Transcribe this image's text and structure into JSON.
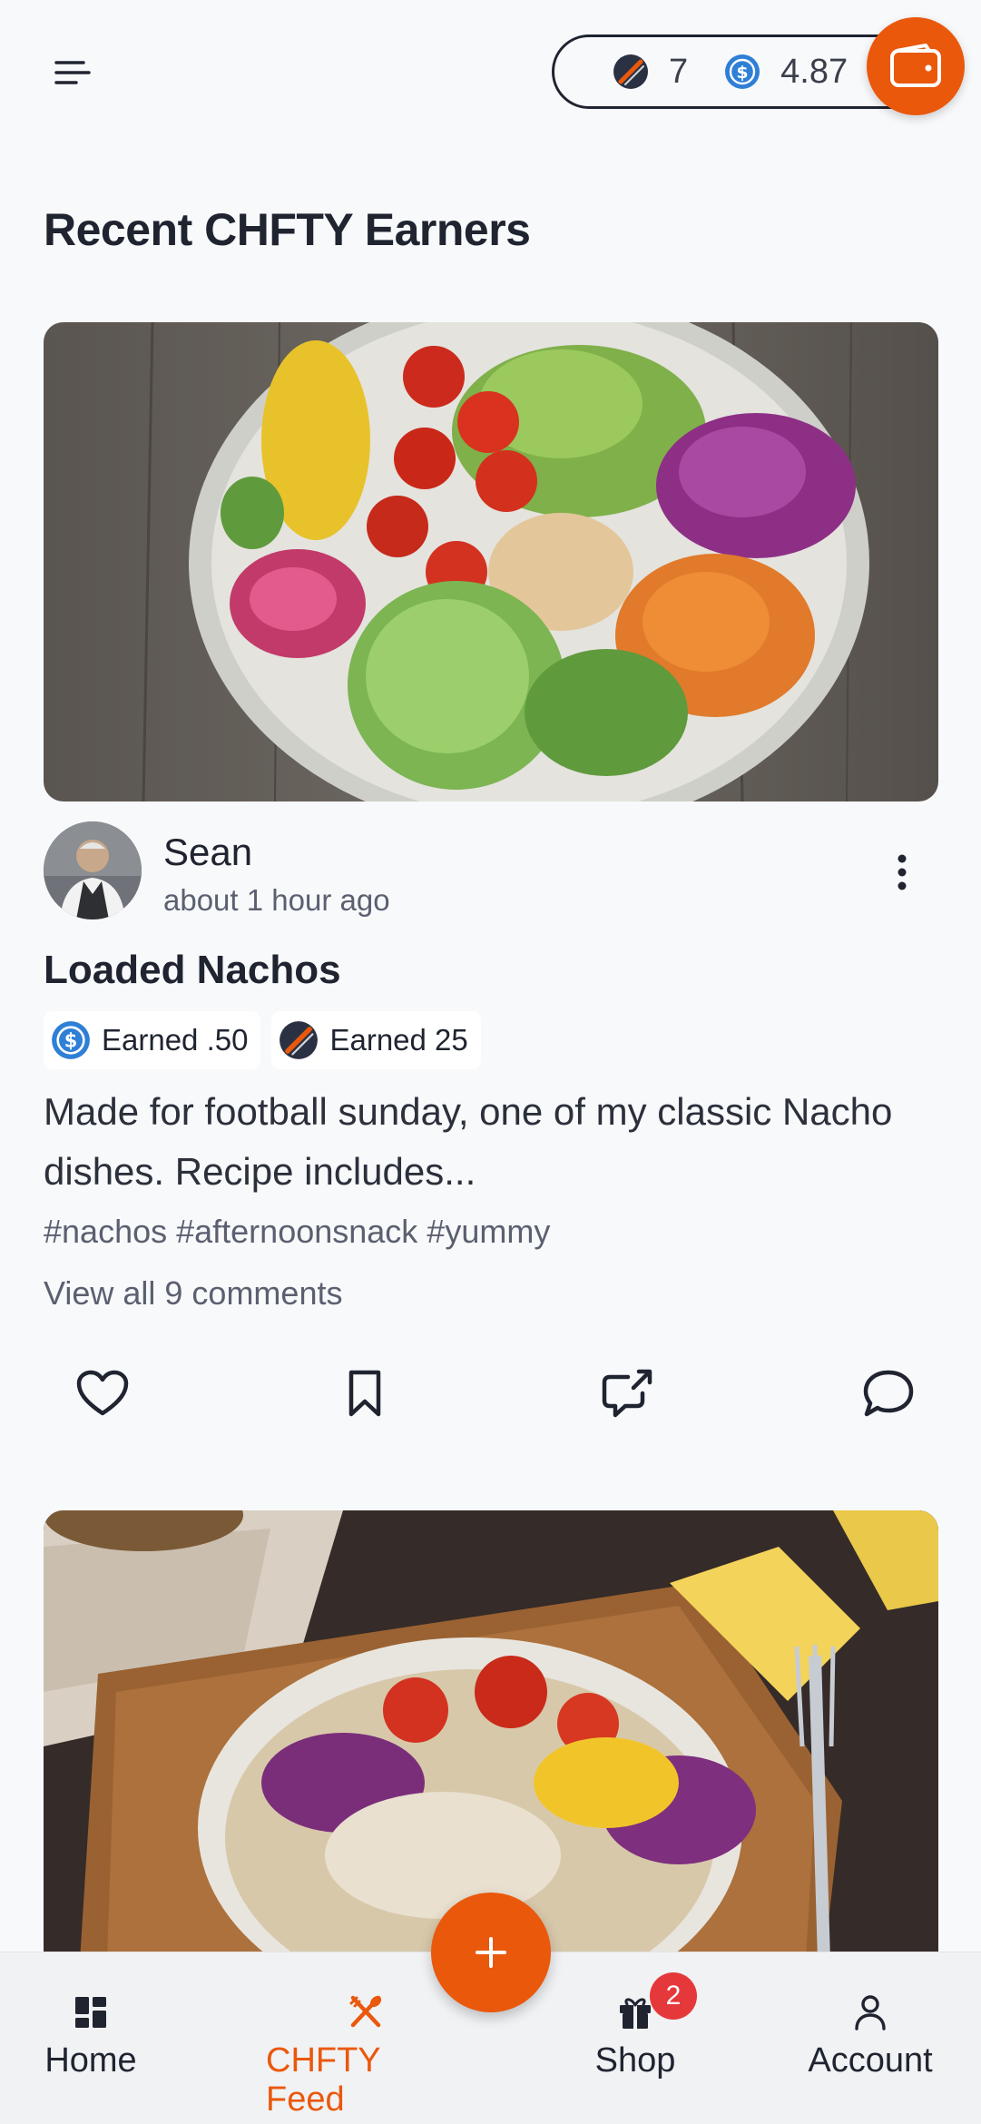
{
  "header": {
    "menu_icon": "menu-icon",
    "token_balance": "7",
    "coin_balance": "4.87",
    "wallet_icon": "wallet-icon"
  },
  "section": {
    "title": "Recent CHFTY Earners"
  },
  "post": {
    "author": "Sean",
    "time": "about 1 hour ago",
    "title": "Loaded Nachos",
    "badges": [
      {
        "icon": "dollar-coin-icon",
        "label": "Earned .50"
      },
      {
        "icon": "chfty-token-icon",
        "label": "Earned 25"
      }
    ],
    "description": "Made for football sunday, one of my classic Nacho dishes. Recipe includes...",
    "tags": "#nachos #afternoonsnack #yummy",
    "comments_link": "View all 9 comments"
  },
  "nav": {
    "items": [
      {
        "label": "Home",
        "icon": "home-grid-icon"
      },
      {
        "label": "CHFTY Feed",
        "icon": "utensils-icon"
      },
      {
        "label": "Shop",
        "icon": "gift-icon"
      },
      {
        "label": "Account",
        "icon": "person-icon"
      }
    ],
    "shop_badge": "2",
    "fab_label": "+"
  },
  "colors": {
    "accent": "#ea580c",
    "text": "#1f2430",
    "muted": "#5b6070",
    "badge_red": "#e5383b",
    "coin_blue": "#2f7fd6"
  }
}
